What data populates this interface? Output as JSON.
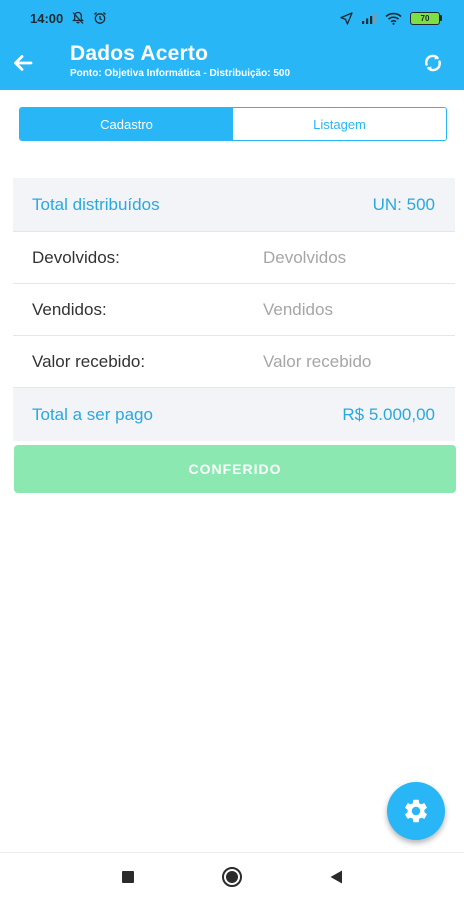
{
  "status_bar": {
    "time": "14:00",
    "battery": "70"
  },
  "app_bar": {
    "title": "Dados Acerto",
    "subtitle": "Ponto: Objetiva Informática - Distribuição: 500"
  },
  "tabs": [
    {
      "label": "Cadastro",
      "active": true
    },
    {
      "label": "Listagem",
      "active": false
    }
  ],
  "form": {
    "total_distribuidos": {
      "label": "Total distribuídos",
      "value": "UN: 500"
    },
    "devolvidos": {
      "label": "Devolvidos:",
      "placeholder": "Devolvidos"
    },
    "vendidos": {
      "label": "Vendidos:",
      "placeholder": "Vendidos"
    },
    "valor_recebido": {
      "label": "Valor recebido:",
      "placeholder": "Valor recebido"
    },
    "total_pago": {
      "label": "Total a ser pago",
      "value": "R$ 5.000,00"
    }
  },
  "confirm_button": {
    "label": "CONFERIDO"
  },
  "icons": {
    "back": "arrow-left-icon",
    "refresh": "sync-icon",
    "settings": "gear-icon",
    "nav_recents": "square-icon",
    "nav_home": "circle-icon",
    "nav_back": "triangle-icon"
  },
  "colors": {
    "primary": "#29b6f6",
    "accent_text": "#29a9e1",
    "confirm_button": "#8ae8b0",
    "highlight_row": "#f2f4f8"
  }
}
